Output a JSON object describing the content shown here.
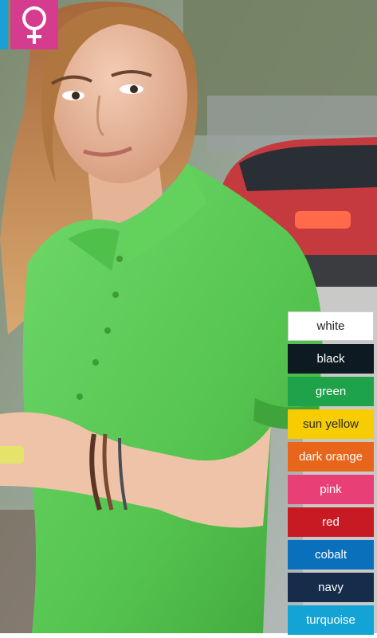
{
  "icons": {
    "gender": "female-symbol-icon"
  },
  "colors": {
    "female_badge": "#d63c8e",
    "side_badge": "#1a9fd6",
    "shirt": "#5fcf58"
  },
  "color_options": [
    {
      "label": "white",
      "hex": "#ffffff"
    },
    {
      "label": "black",
      "hex": "#0d1a21"
    },
    {
      "label": "green",
      "hex": "#1ea24a"
    },
    {
      "label": "sun yellow",
      "hex": "#f7cc00"
    },
    {
      "label": "dark orange",
      "hex": "#e8661b"
    },
    {
      "label": "pink",
      "hex": "#e83f77"
    },
    {
      "label": "red",
      "hex": "#c81a22"
    },
    {
      "label": "cobalt",
      "hex": "#0a70bb"
    },
    {
      "label": "navy",
      "hex": "#172c4a"
    },
    {
      "label": "turquoise",
      "hex": "#13a3d4"
    }
  ]
}
